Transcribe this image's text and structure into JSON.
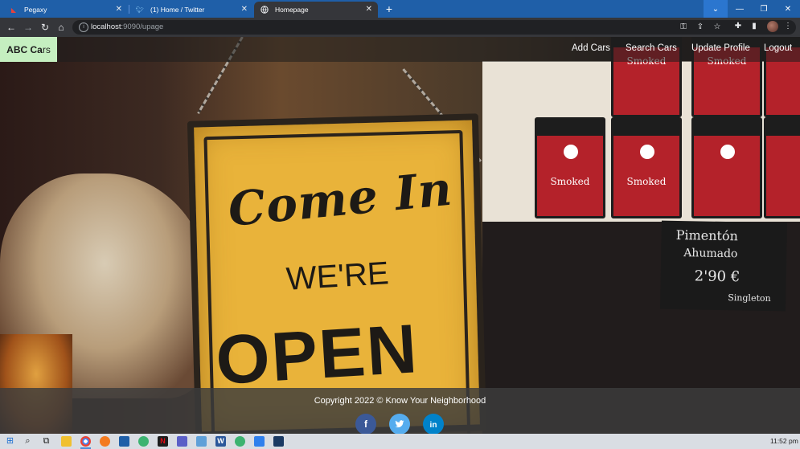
{
  "browser": {
    "tabs": [
      {
        "title": "Pegaxy",
        "icon": "pegaxy-icon",
        "active": false
      },
      {
        "title": "(1) Home / Twitter",
        "icon": "twitter-icon",
        "active": false
      },
      {
        "title": "Homepage",
        "icon": "globe-icon",
        "active": true
      }
    ],
    "url_host": "localhost",
    "url_path": ":9090/upage"
  },
  "app": {
    "brand_bold": "ABC Ca",
    "brand_rest": "rs",
    "nav": [
      "Add Cars",
      "Search Cars",
      "Update Profile",
      "Logout"
    ]
  },
  "hero": {
    "sign_line1": "Come In",
    "sign_line2": "WE'RE",
    "sign_line3": "OPEN",
    "tin_label": "Smoked",
    "chalk_line1": "Pimentón",
    "chalk_line2": "Ahumado",
    "chalk_price": "2'90 €",
    "chalk_sig": "Singleton"
  },
  "footer": {
    "copyright": "Copyright 2022 © Know Your Neighborhood",
    "social": [
      {
        "name": "facebook",
        "glyph": "f",
        "color": "#3b5998"
      },
      {
        "name": "twitter",
        "glyph": "t",
        "color": "#55acee"
      },
      {
        "name": "linkedin",
        "glyph": "in",
        "color": "#0082ca"
      }
    ]
  },
  "taskbar": {
    "time": "11:52 pm"
  }
}
